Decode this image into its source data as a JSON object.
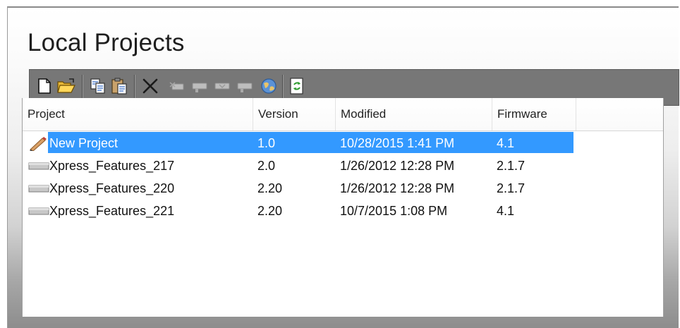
{
  "page": {
    "title": "Local Projects"
  },
  "toolbar": {
    "buttons": [
      {
        "name": "new-project",
        "icon": "new-document-icon"
      },
      {
        "name": "open-project",
        "icon": "open-folder-icon"
      },
      {
        "name": "copy",
        "icon": "copy-icon"
      },
      {
        "name": "paste",
        "icon": "paste-icon"
      },
      {
        "name": "delete",
        "icon": "delete-x-icon"
      },
      {
        "name": "import-device",
        "icon": "device-import-icon"
      },
      {
        "name": "export-device",
        "icon": "device-export-icon"
      },
      {
        "name": "device-sync",
        "icon": "device-sync-icon"
      },
      {
        "name": "device-link",
        "icon": "device-link-icon"
      },
      {
        "name": "web",
        "icon": "globe-icon"
      },
      {
        "name": "refresh",
        "icon": "refresh-icon"
      }
    ]
  },
  "list": {
    "columns": [
      "Project",
      "Version",
      "Modified",
      "Firmware"
    ],
    "rows": [
      {
        "project": "New Project",
        "version": "1.0",
        "modified": "10/28/2015 1:41 PM",
        "firmware": "4.1",
        "icon": "pencil-icon",
        "selected": true
      },
      {
        "project": "Xpress_Features_217",
        "version": "2.0",
        "modified": "1/26/2012 12:28 PM",
        "firmware": "2.1.7",
        "icon": "device-icon",
        "selected": false
      },
      {
        "project": "Xpress_Features_220",
        "version": "2.20",
        "modified": "1/26/2012 12:28 PM",
        "firmware": "2.1.7",
        "icon": "device-icon",
        "selected": false
      },
      {
        "project": "Xpress_Features_221",
        "version": "2.20",
        "modified": "10/7/2015 1:08 PM",
        "firmware": "4.1",
        "icon": "device-icon",
        "selected": false
      }
    ]
  },
  "colors": {
    "selection": "#3399ff",
    "toolbar_bg": "#777777"
  }
}
